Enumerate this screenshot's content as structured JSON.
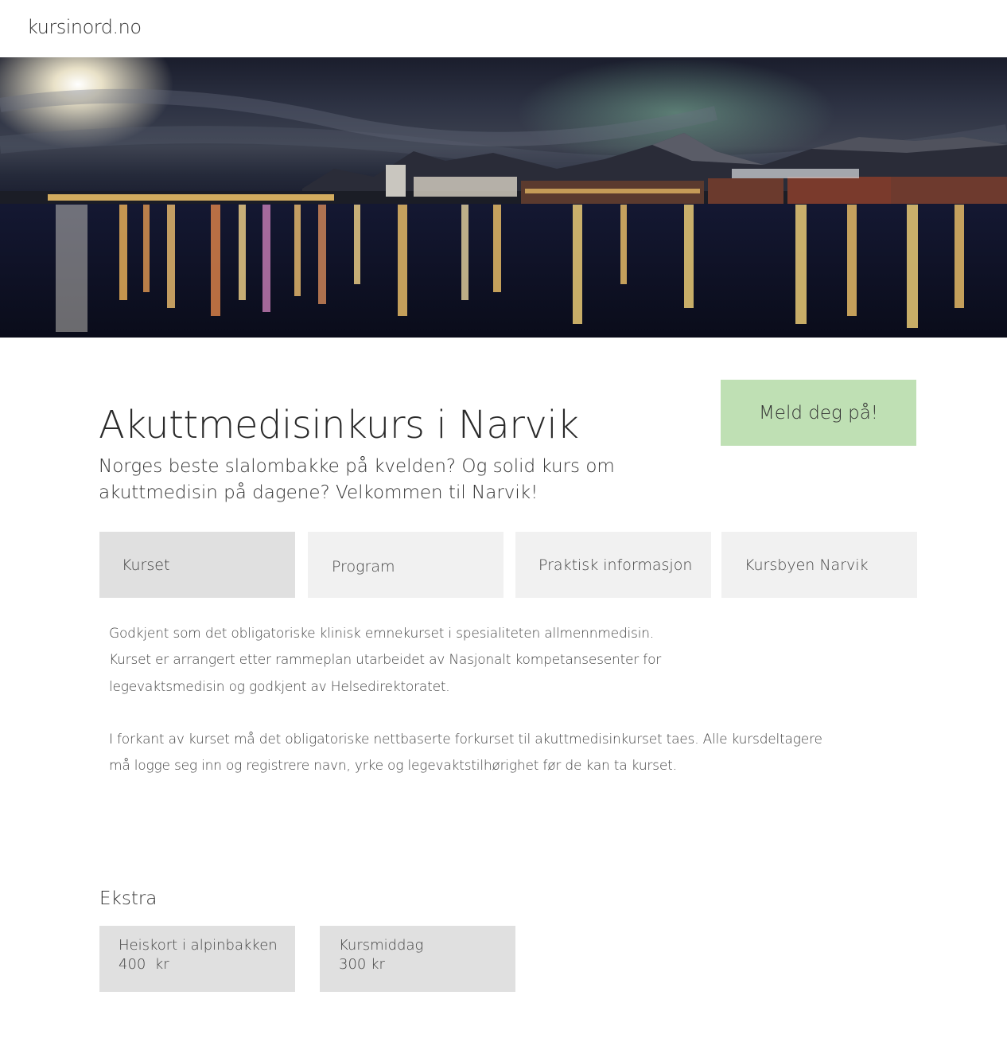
{
  "header": {
    "site_name": "kursinord.no"
  },
  "hero": {
    "image": "Night harbour panorama with city lights reflected on water, mountains and northern lights"
  },
  "course": {
    "title": "Akuttmedisinkurs i Narvik",
    "lead": "Norges beste slalombakke på kvelden? Og solid kurs om akuttmedisin på dagene? Velkommen til Narvik!",
    "signup_label": "Meld deg på!",
    "signup_color": "#bfe0b4"
  },
  "tabs": [
    {
      "label": "Kurset",
      "active": true
    },
    {
      "label": "Program",
      "active": false
    },
    {
      "label": "Praktisk informasjon",
      "active": false
    },
    {
      "label": "Kursbyen Narvik",
      "active": false
    }
  ],
  "content": {
    "paragraph_1": "Godkjent som det obligatoriske klinisk emnekurset i spesialiteten allmennmedisin. Kurset er arrangert etter rammeplan utarbeidet av Nasjonalt kompetansesenter for legevaktsmedisin og godkjent av Helsedirektoratet.",
    "paragraph_2": "I forkant av kurset må det obligatoriske nettbaserte forkurset til akuttmedisinkurset taes. Alle kursdeltagere må logge seg inn og registrere navn, yrke og legevaktstilhørighet før de kan ta kurset."
  },
  "extras": {
    "heading": "Ekstra",
    "items": [
      {
        "name": "Heiskort i alpinbakken",
        "price": "400  kr"
      },
      {
        "name": "Kursmiddag",
        "price": "300 kr"
      }
    ]
  }
}
